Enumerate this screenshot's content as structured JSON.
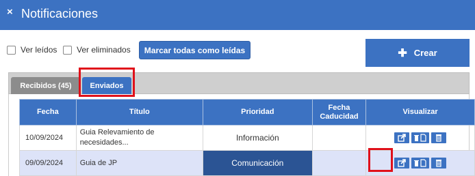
{
  "header": {
    "close_glyph": "×",
    "title": "Notificaciones"
  },
  "toolbar": {
    "checkbox_read": {
      "label": "Ver leídos",
      "checked": false
    },
    "checkbox_deleted": {
      "label": "Ver eliminados",
      "checked": false
    },
    "mark_all_read_label": "Marcar todas como leídas",
    "create_icon": "plus-icon",
    "create_label": "Crear"
  },
  "tabs": [
    {
      "label": "Recibidos (45)",
      "active": false
    },
    {
      "label": "Enviados",
      "active": true
    }
  ],
  "table": {
    "columns": [
      "Fecha",
      "Título",
      "Prioridad",
      "Fecha Caducidad",
      "Visualizar"
    ],
    "column_lines": {
      "fecha_caducidad": [
        "Fecha",
        "Caducidad"
      ]
    },
    "rows": [
      {
        "fecha": "10/09/2024",
        "titulo_line1": "Guia Relevamiento de",
        "titulo_line2": "necesidades...",
        "prioridad": "Información",
        "fecha_caducidad": ""
      },
      {
        "fecha": "09/09/2024",
        "titulo_line1": "Guia de JP",
        "titulo_line2": "",
        "prioridad": "Comunicación",
        "fecha_caducidad": ""
      }
    ],
    "action_icons": [
      "external-link-icon",
      "delete-file-icon",
      "trash-icon"
    ]
  },
  "colors": {
    "header": "#3c72c2",
    "priority_comunicacion_bg": "#2b5494",
    "highlight_border": "#e0101a",
    "selected_row_bg": "#dde3f8"
  }
}
